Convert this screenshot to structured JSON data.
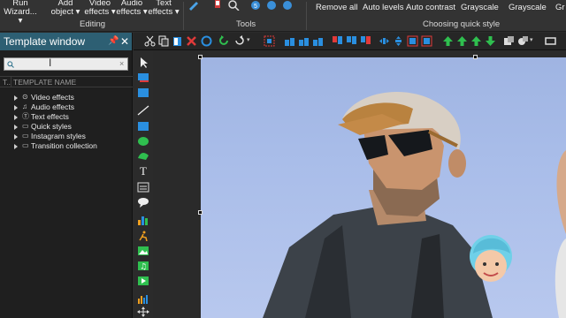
{
  "ribbon": {
    "buttons": [
      {
        "label": "Run\nWizard...",
        "name": "run-wizard-button"
      },
      {
        "label": "Add\nobject",
        "name": "add-object-button"
      },
      {
        "label": "Video\neffects",
        "name": "video-effects-button"
      },
      {
        "label": "Audio\neffects",
        "name": "audio-effects-button"
      },
      {
        "label": "Text\neffects",
        "name": "text-effects-button"
      }
    ],
    "group_editing": "Editing",
    "group_tools": "Tools",
    "group_quick_style": "Choosing quick style",
    "quick_styles": [
      "Remove all",
      "Auto levels",
      "Auto contrast",
      "Grayscale",
      "Grayscale",
      "Gr"
    ]
  },
  "template_window": {
    "title": "Template window",
    "search_value": "",
    "column_type": "T..",
    "column_name": "TEMPLATE NAME",
    "items": [
      {
        "label": "Video effects",
        "icon": "film-icon"
      },
      {
        "label": "Audio effects",
        "icon": "headphones-icon"
      },
      {
        "label": "Text effects",
        "icon": "text-icon"
      },
      {
        "label": "Quick styles",
        "icon": "folder-icon"
      },
      {
        "label": "Instagram styles",
        "icon": "folder-icon"
      },
      {
        "label": "Transition collection",
        "icon": "folder-icon"
      }
    ]
  },
  "colors": {
    "accent_title": "#2d5f73",
    "green": "#2fbf4f",
    "blue": "#2a8fe0",
    "red": "#e03a3a"
  }
}
